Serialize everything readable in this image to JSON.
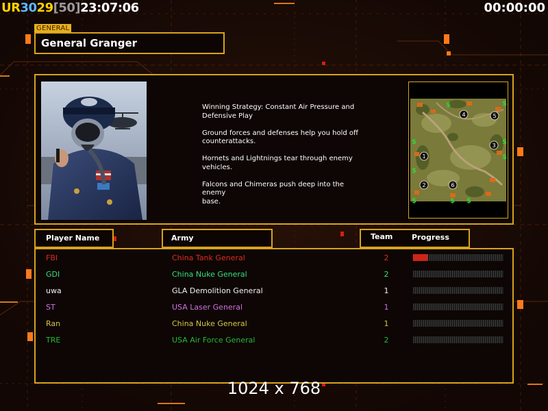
{
  "hud": {
    "stats": [
      {
        "text": "UR",
        "color": "#ffd200"
      },
      {
        "text": " 30",
        "color": "#5cb8ff"
      },
      {
        "text": " 29",
        "color": "#ffd200"
      },
      {
        "text": "[50]",
        "color": "#9a9a9a"
      },
      {
        "text": " 23:07:06",
        "color": "#ffffff"
      }
    ],
    "clock_right": "00:00:00"
  },
  "general": {
    "tag": "GENERAL",
    "name": "General Granger"
  },
  "strategy": [
    "Winning Strategy: Constant Air Pressure and\n Defensive Play",
    "Ground forces and defenses help you hold off\n counterattacks.",
    "Hornets and Lightnings tear through enemy\n vehicles.",
    "Falcons and Chimeras push deep into the enemy\n base."
  ],
  "columns": {
    "player_name": "Player Name",
    "army": "Army",
    "team": "Team",
    "progress": "Progress"
  },
  "players": [
    {
      "name": "FBI",
      "army": "China Tank General",
      "team": "2",
      "color": "#e02b1e",
      "progress": 0.16
    },
    {
      "name": "GDI",
      "army": "China Nuke General",
      "team": "2",
      "color": "#33e07c",
      "progress": 0
    },
    {
      "name": "uwa",
      "army": "GLA Demolition General",
      "team": "1",
      "color": "#f2f2f2",
      "progress": 0
    },
    {
      "name": "ST",
      "army": "USA Laser General",
      "team": "1",
      "color": "#d46fe0",
      "progress": 0
    },
    {
      "name": "Ran",
      "army": "China Nuke General",
      "team": "1",
      "color": "#d6c64a",
      "progress": 0
    },
    {
      "name": "TRE",
      "army": "USA Air Force General",
      "team": "2",
      "color": "#27b83a",
      "progress": 0
    }
  ],
  "minimap": {
    "start_positions": [
      "1",
      "2",
      "3",
      "4",
      "5",
      "6"
    ]
  },
  "resolution": "1024 x 768"
}
